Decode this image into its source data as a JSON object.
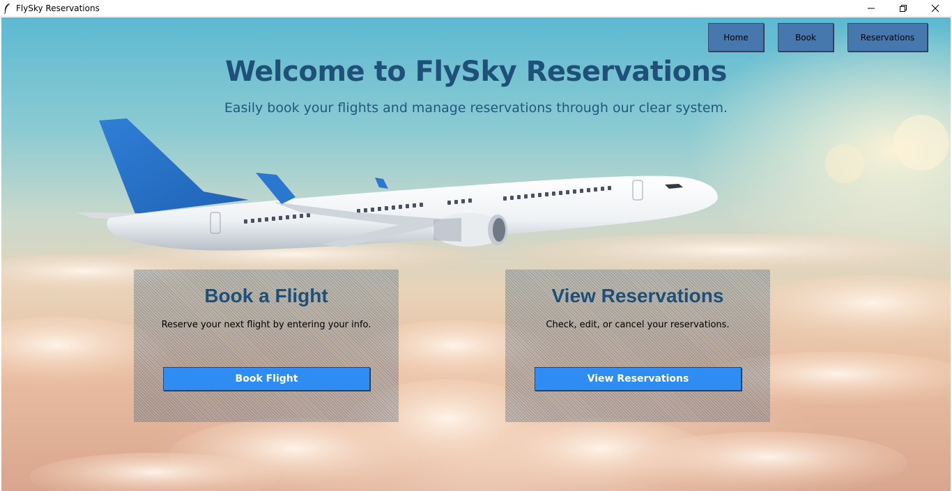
{
  "window": {
    "title": "FlySky Reservations",
    "controls": {
      "minimize": "minimize-icon",
      "restore": "restore-icon",
      "close": "close-icon"
    }
  },
  "nav": {
    "home_label": "Home",
    "book_label": "Book",
    "reservations_label": "Reservations"
  },
  "hero": {
    "title": "Welcome to FlySky Reservations",
    "subtitle": "Easily book your flights and manage reservations through our clear system."
  },
  "cards": [
    {
      "title": "Book a Flight",
      "description": "Reserve your next flight by entering your info.",
      "button_label": "Book Flight"
    },
    {
      "title": "View Reservations",
      "description": "Check, edit, or cancel your reservations.",
      "button_label": "View Reservations"
    }
  ],
  "colors": {
    "nav_button": "#4678ad",
    "action_button": "#2f8cf2",
    "heading": "#1f5077",
    "sky_top": "#5cb9d2",
    "sky_bottom": "#d9a58e"
  }
}
